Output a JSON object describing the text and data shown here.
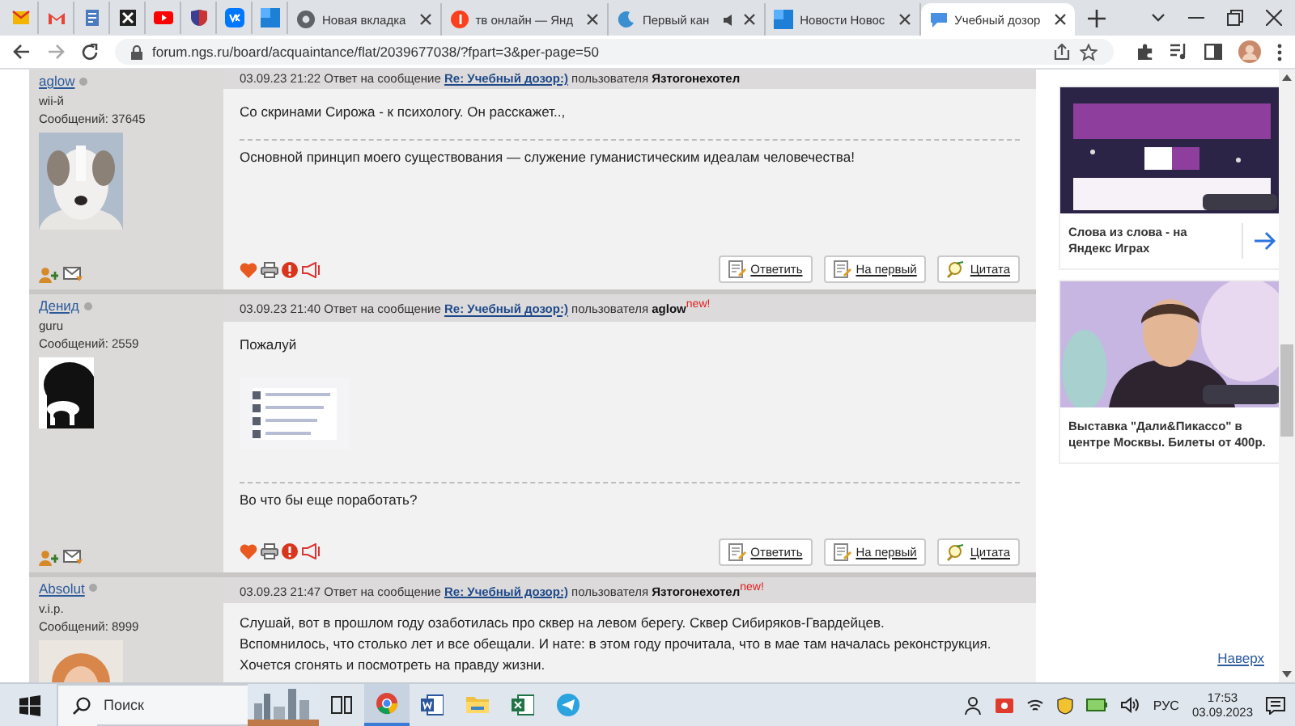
{
  "browser": {
    "pinned_tabs": [
      {
        "selected": false
      },
      {
        "selected": false
      },
      {
        "selected": false
      },
      {
        "selected": false
      },
      {
        "selected": false
      },
      {
        "selected": false
      },
      {
        "selected": false
      },
      {
        "selected": false
      }
    ],
    "tabs": [
      {
        "title": "Новая вкладка",
        "selected": false,
        "audio": false
      },
      {
        "title": "тв онлайн — Янд",
        "selected": false,
        "audio": false
      },
      {
        "title": "Первый кан",
        "selected": false,
        "audio": true
      },
      {
        "title": "Новости Новос",
        "selected": false,
        "audio": false
      },
      {
        "title": "Учебный дозор",
        "selected": true,
        "audio": false
      }
    ],
    "address": "forum.ngs.ru/board/acquaintance/flat/2039677038/?fpart=3&per-page=50"
  },
  "posts": [
    {
      "author": "aglow",
      "online": false,
      "rank": "wii-й",
      "post_count": "Сообщений: 37645",
      "time": "03.09.23 21:22",
      "reply_prefix": "Ответ на сообщение",
      "thread": "Re: Учебный дозор:)",
      "user_prefix": "пользователя",
      "reply_to": "Язтогонехотел",
      "body": [
        "Со скринами Сирожа - к психологу. Он расскажет..,"
      ],
      "signature": "Основной принцип моего существования — служение гуманистическим идеалам человечества!",
      "actions": [
        "Ответить",
        "На первый",
        "Цитата"
      ]
    },
    {
      "author": "Денид",
      "online": false,
      "rank": "guru",
      "post_count": "Сообщений: 2559",
      "time": "03.09.23 21:40",
      "reply_prefix": "Ответ на сообщение",
      "thread": "Re: Учебный дозор:)",
      "user_prefix": "пользователя",
      "reply_to": "aglow",
      "new_mark": "new!",
      "body": [
        "Пожалуй"
      ],
      "attachment": {
        "kind": "picture"
      },
      "signature": "Во что бы еще поработать?",
      "actions": [
        "Ответить",
        "На первый",
        "Цитата"
      ]
    },
    {
      "author": "Absolut",
      "online": false,
      "rank": "v.i.p.",
      "post_count": "Сообщений: 8999",
      "time": "03.09.23 21:47",
      "reply_prefix": "Ответ на сообщение",
      "thread": "Re: Учебный дозор:)",
      "user_prefix": "пользователя",
      "reply_to": "Язтогонехотел",
      "new_mark": "new!",
      "body": [
        "Слушай, вот в прошлом году озаботилась про сквер на левом берегу. Сквер Сибиряков-Гвардейцев.",
        "Вспомнилось, что столько лет и все обещали. И нате: в этом году прочитала, что в мае там началась реконструкция.",
        "Хочется сгонять и посмотреть на правду жизни."
      ]
    }
  ],
  "ads": [
    {
      "caption": "Слова из слова - на Яндекс Играх",
      "arrow": true
    },
    {
      "caption": "Выставка \"Дали&Пикассо\" в центре Москвы. Билеты от 400р.",
      "arrow": false
    }
  ],
  "scroll_top_link": "Наверх",
  "taskbar": {
    "search_placeholder": "Поиск",
    "apps": [
      {
        "selected": false
      },
      {
        "selected": true
      },
      {
        "selected": false
      },
      {
        "selected": false
      },
      {
        "selected": false
      },
      {
        "selected": false
      }
    ],
    "language": "РУС",
    "time": "17:53",
    "date": "03.09.2023"
  }
}
